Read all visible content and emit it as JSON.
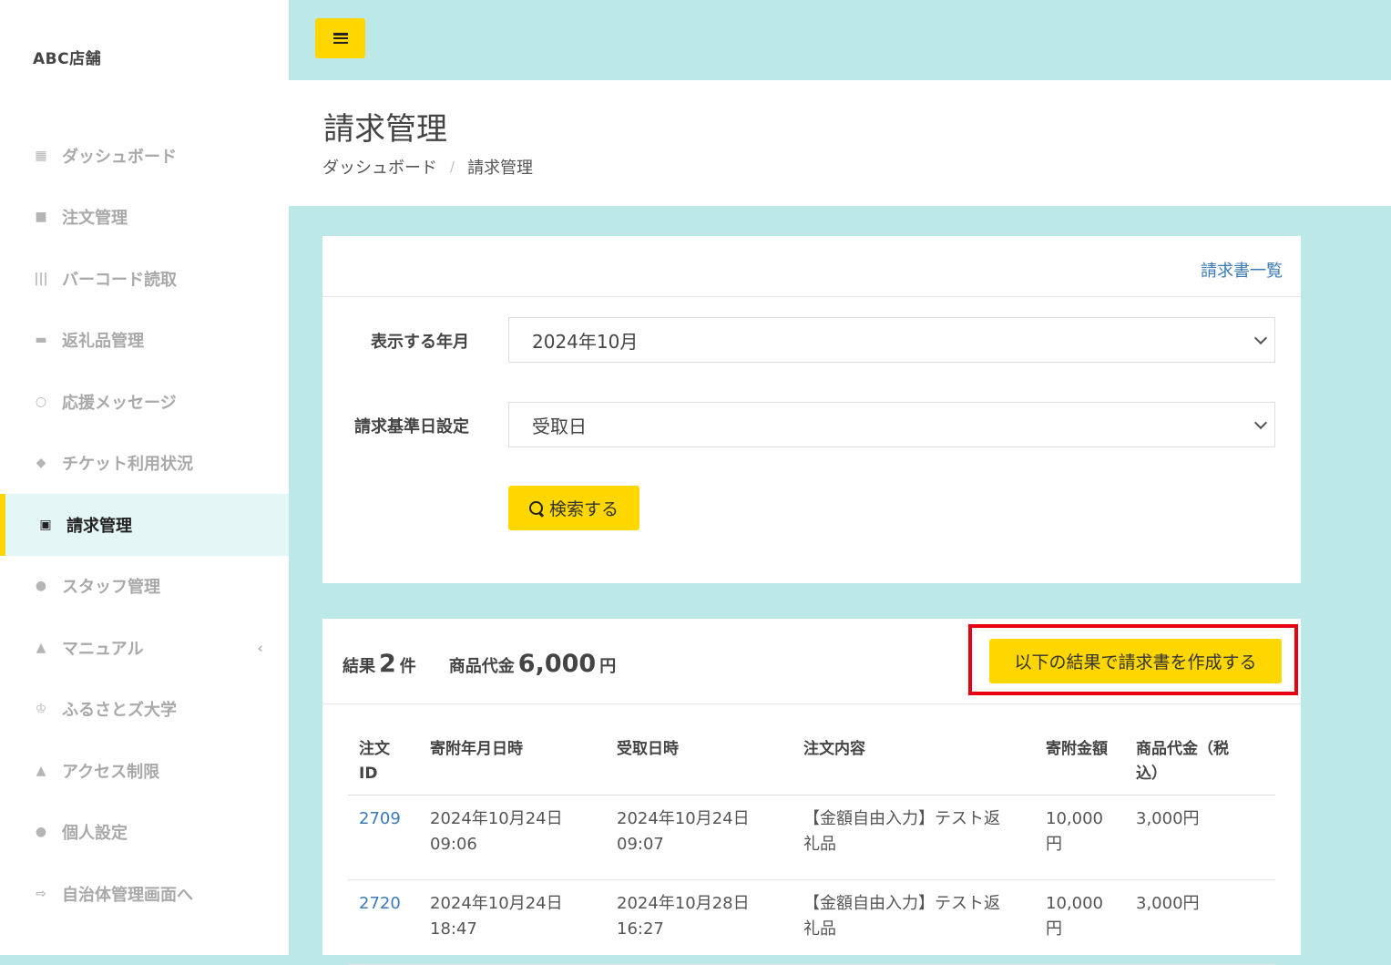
{
  "sidebar": {
    "brand": "ABC店舗",
    "items": [
      {
        "label": "ダッシュボード",
        "icon": "dashboard-icon"
      },
      {
        "label": "注文管理",
        "icon": "shopping-bag-icon"
      },
      {
        "label": "バーコード読取",
        "icon": "barcode-icon"
      },
      {
        "label": "返礼品管理",
        "icon": "gift-icon"
      },
      {
        "label": "応援メッセージ",
        "icon": "speech-bubble-icon"
      },
      {
        "label": "チケット利用状況",
        "icon": "ticket-icon"
      },
      {
        "label": "請求管理",
        "icon": "money-icon",
        "active": true
      },
      {
        "label": "スタッフ管理",
        "icon": "users-icon"
      },
      {
        "label": "マニュアル",
        "icon": "graduation-cap-icon"
      },
      {
        "label": "ふるさとズ大学",
        "icon": "trophy-icon"
      },
      {
        "label": "アクセス制限",
        "icon": "warning-icon"
      },
      {
        "label": "個人設定",
        "icon": "user-icon"
      },
      {
        "label": "自治体管理画面へ",
        "icon": "sign-out-icon"
      }
    ]
  },
  "header": {
    "title": "請求管理",
    "breadcrumb": [
      "ダッシュボード",
      "請求管理"
    ],
    "breadcrumb_sep": "/"
  },
  "filter": {
    "invoice_list_link": "請求書一覧",
    "month_label": "表示する年月",
    "month_value": "2024年10月",
    "basis_label": "請求基準日設定",
    "basis_value": "受取日",
    "search_button": "検索する"
  },
  "results": {
    "count_label": "結果",
    "count": "2",
    "count_unit": "件",
    "amount_label": "商品代金",
    "amount": "6,000",
    "amount_unit": "円",
    "create_button": "以下の結果で請求書を作成する",
    "highlight_color": "#e60012"
  },
  "table": {
    "headers": [
      "注文\nID",
      "寄附年月日時",
      "受取日時",
      "注文内容",
      "寄附金額",
      "商品代金（税\n込）"
    ],
    "rows": [
      {
        "id": "2709",
        "donated_at": "2024年10月24日\n09:06",
        "received_at": "2024年10月24日\n09:07",
        "content": "【金額自由入力】テスト返\n礼品",
        "donation": "10,000\n円",
        "price": "3,000円"
      },
      {
        "id": "2720",
        "donated_at": "2024年10月24日\n18:47",
        "received_at": "2024年10月28日\n16:27",
        "content": "【金額自由入力】テスト返\n礼品",
        "donation": "10,000\n円",
        "price": "3,000円"
      }
    ]
  },
  "colors": {
    "accent": "#ffd700",
    "background": "#bde8e8",
    "link": "#3a7ab8"
  }
}
